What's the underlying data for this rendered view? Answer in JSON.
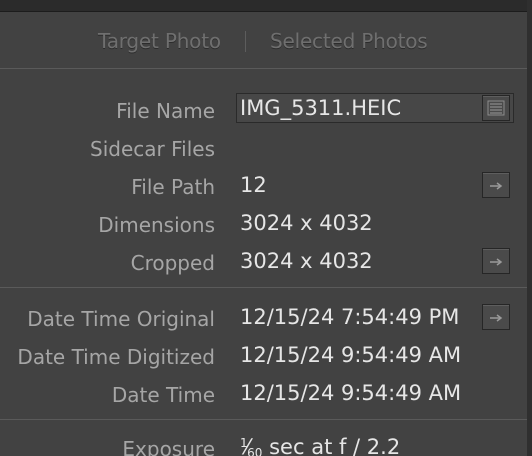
{
  "tabs": {
    "target_photo": "Target Photo",
    "selected_photos": "Selected Photos"
  },
  "file_name": {
    "label": "File Name",
    "value": "IMG_5311.HEIC"
  },
  "sidecar_files": {
    "label": "Sidecar Files"
  },
  "file_path": {
    "label": "File Path",
    "value": "12"
  },
  "dimensions": {
    "label": "Dimensions",
    "value": "3024 x 4032"
  },
  "cropped": {
    "label": "Cropped",
    "value": "3024 x 4032"
  },
  "date_time_original": {
    "label": "Date Time Original",
    "value": "12/15/24 7:54:49 PM"
  },
  "date_time_digitized": {
    "label": "Date Time Digitized",
    "value": "12/15/24 9:54:49 AM"
  },
  "date_time": {
    "label": "Date Time",
    "value": "12/15/24 9:54:49 AM"
  },
  "exposure": {
    "label": "Exposure",
    "numerator": "1",
    "denominator": "60",
    "rest": " sec at f / 2.2"
  },
  "icons": {
    "file_name_button": "list-icon",
    "go_to_button": "arrow-right-icon"
  },
  "colors": {
    "panel": "#424242",
    "label": "#a6a6a6",
    "value": "#e6e6e6",
    "tab_text": "#6f6f6f"
  }
}
